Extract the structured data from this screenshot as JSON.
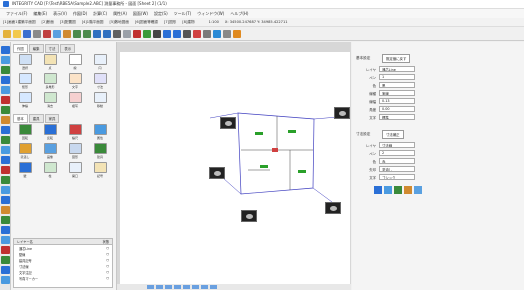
{
  "window": {
    "title": "INTEGRITY CAD [F:\\Test\\RBE5A\\Sample2.ABC] 測量事務所 - 図面 [Sheet 2] (1/1)"
  },
  "menu": [
    "ファイル(F)",
    "編集(E)",
    "表示(V)",
    "作図(D)",
    "計算(C)",
    "属性(A)",
    "図面(W)",
    "設定(S)",
    "ツール(T)",
    "ウィンドウ(W)",
    "ヘルプ(H)"
  ],
  "filetabs": [
    "[1]画面1建築平面図",
    "[2]断面",
    "[3]配置図",
    "[4]1階平面図",
    "[5]敷地図面",
    "[6]図面等確認",
    "[7]図形",
    "[8]建物"
  ],
  "scale_label": "1:100",
  "coords": "X: 34500.247687  Y: 34985.422711",
  "toolbar_icons": [
    "new-icon",
    "open-icon",
    "save-icon",
    "print-icon",
    "cut-icon",
    "copy-icon",
    "paste-icon",
    "undo-icon",
    "redo-icon",
    "zoom-in-icon",
    "zoom-out-icon",
    "pan-icon",
    "grid-icon",
    "snap-icon",
    "layer-icon",
    "select-icon",
    "line-icon",
    "arc-icon",
    "text-icon",
    "dimension-icon",
    "hatch-icon",
    "measure-icon",
    "settings-icon",
    "help-icon"
  ],
  "palette": {
    "tabs": [
      "作図",
      "編集",
      "寸法",
      "表示"
    ],
    "subtabs": [
      "基本",
      "建具",
      "家具"
    ],
    "items": [
      "選択",
      "点",
      "線",
      "円",
      "矩形",
      "多角形",
      "文字",
      "寸法",
      "伸縮",
      "消去",
      "複写",
      "移動",
      "回転",
      "反転",
      "縮尺",
      "属性",
      "塗潰し",
      "画像",
      "図形",
      "建具",
      "壁",
      "柱",
      "開口",
      "記号"
    ]
  },
  "layer_list": {
    "header_name": "レイヤー名",
    "header_status": "状態",
    "rows": [
      {
        "name": "通芯Line",
        "status": "○"
      },
      {
        "name": "壁線",
        "status": "○"
      },
      {
        "name": "建具記号",
        "status": "○"
      },
      {
        "name": "寸法線",
        "status": "○"
      },
      {
        "name": "文字注記",
        "status": "○"
      },
      {
        "name": "写真マーカー",
        "status": "○"
      }
    ]
  },
  "properties": {
    "title": "基本設定",
    "reset_label": "既定値に戻す",
    "rows": [
      {
        "k": "レイヤ",
        "v": "通芯Line"
      },
      {
        "k": "ペン",
        "v": "1"
      },
      {
        "k": "色",
        "v": "黒"
      },
      {
        "k": "線種",
        "v": "実線"
      },
      {
        "k": "線幅",
        "v": "0.13"
      },
      {
        "k": "角度",
        "v": "0.00"
      },
      {
        "k": "文字",
        "v": "標準"
      }
    ],
    "section2_title": "寸法設定",
    "section2_button": "寸法補正",
    "rows2": [
      {
        "k": "レイヤ",
        "v": "寸法線"
      },
      {
        "k": "ペン",
        "v": "2"
      },
      {
        "k": "色",
        "v": "赤"
      },
      {
        "k": "矢印",
        "v": "塗潰し"
      },
      {
        "k": "文字",
        "v": "ゴシック"
      }
    ]
  },
  "colors": {
    "accent": "#2a6fd6",
    "plan_line": "#4040c0",
    "room_text": "#2aa02a"
  }
}
